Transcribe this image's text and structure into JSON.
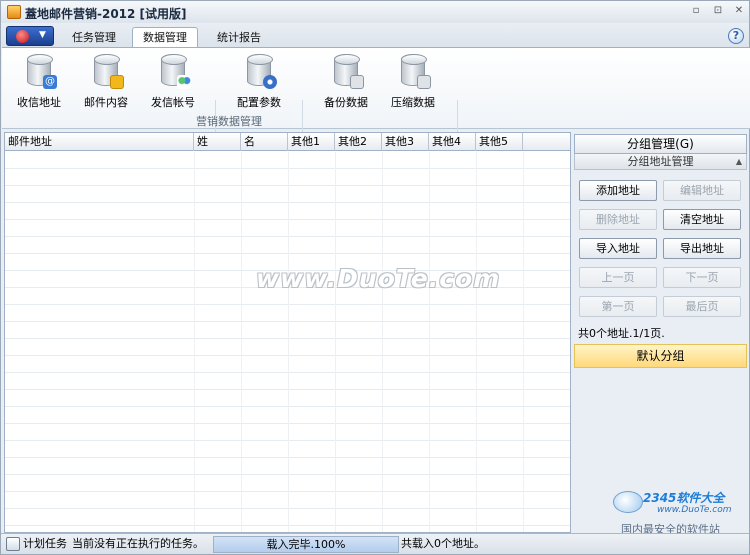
{
  "window": {
    "title": "蓋地邮件营销-2012 [试用版]",
    "min": "▫",
    "max": "⊡",
    "close": "✕"
  },
  "tabs": [
    {
      "label": "任务管理"
    },
    {
      "label": "数据管理"
    },
    {
      "label": "统计报告"
    }
  ],
  "ribbon": {
    "buttons": [
      {
        "label": "收信地址",
        "badge": "at-icon",
        "color": "#3a7bd5"
      },
      {
        "label": "邮件内容",
        "badge": "mail-icon",
        "color": "#f0b818"
      },
      {
        "label": "发信帐号",
        "badge": "users-icon",
        "color": "#3aa35a"
      },
      {
        "label": "配置参数",
        "badge": "gear-icon",
        "color": "#3a6fc8"
      },
      {
        "label": "备份数据",
        "badge": "backup-icon",
        "color": "#8c96a2"
      },
      {
        "label": "压缩数据",
        "badge": "compress-icon",
        "color": "#8c96a2"
      }
    ],
    "group_label": "营销数据管理"
  },
  "grid": {
    "columns": [
      "邮件地址",
      "姓",
      "名",
      "其他1",
      "其他2",
      "其他3",
      "其他4",
      "其他5"
    ]
  },
  "watermark": "www.DuoTe.com",
  "side": {
    "group_button": "分组管理(G)",
    "address_header": "分组地址管理",
    "buttons": {
      "add": "添加地址",
      "edit": "编辑地址",
      "delete": "删除地址",
      "clear": "清空地址",
      "import": "导入地址",
      "export": "导出地址",
      "prev": "上一页",
      "next": "下一页",
      "first": "第一页",
      "last": "最后页"
    },
    "count": "共0个地址.1/1页.",
    "default_group": "默认分组"
  },
  "logo": {
    "brand": "2345软件大全",
    "url": "www.DuoTe.com",
    "slogan": "国内最安全的软件站"
  },
  "status": {
    "task_label": "计划任务",
    "current": "当前没有正在执行的任务。",
    "progress": "载入完毕.100%",
    "progress_value": 100,
    "loaded": "共载入0个地址。"
  }
}
